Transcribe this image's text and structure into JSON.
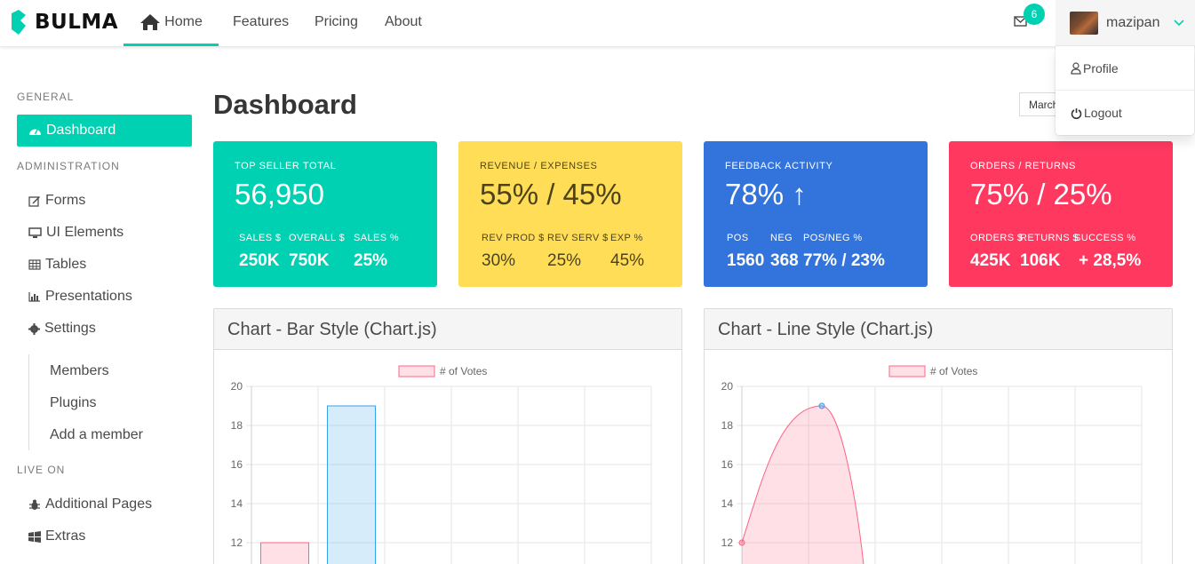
{
  "navbar": {
    "brand": "BULMA",
    "links": [
      "Home",
      "Features",
      "Pricing",
      "About"
    ],
    "messages_count": "6",
    "username": "mazipan"
  },
  "user_menu": {
    "profile": "Profile",
    "logout": "Logout"
  },
  "sidebar": {
    "general_label": "GENERAL",
    "dashboard": "Dashboard",
    "administration_label": "ADMINISTRATION",
    "forms": "Forms",
    "ui_elements": "UI Elements",
    "tables": "Tables",
    "presentations": "Presentations",
    "settings": "Settings",
    "settings_children": [
      "Members",
      "Plugins",
      "Add a member"
    ],
    "live_on_label": "LIVE ON",
    "additional_pages": "Additional Pages",
    "extras": "Extras"
  },
  "main": {
    "title": "Dashboard",
    "month_select": "March"
  },
  "tiles": [
    {
      "label": "TOP SELLER TOTAL",
      "value": "56,950",
      "subs": [
        "SALES $",
        "OVERALL $",
        "SALES %"
      ],
      "nums": [
        "250K",
        "750K",
        "25%"
      ]
    },
    {
      "label": "REVENUE / EXPENSES",
      "value": "55% / 45%",
      "subs": [
        "REV PROD $",
        "REV SERV $",
        "EXP %"
      ],
      "nums": [
        "30%",
        "25%",
        "45%"
      ]
    },
    {
      "label": "FEEDBACK ACTIVITY",
      "value": "78% ↑",
      "subs": [
        "POS",
        "NEG",
        "POS/NEG %"
      ],
      "nums": [
        "1560",
        "368",
        "77% / 23%"
      ]
    },
    {
      "label": "ORDERS / RETURNS",
      "value": "75% / 25%",
      "subs": [
        "ORDERS $",
        "RETURNS $",
        "SUCCESS %"
      ],
      "nums": [
        "425K",
        "106K",
        "+ 28,5%"
      ]
    }
  ],
  "charts": {
    "bar_title": "Chart - Bar Style (Chart.js)",
    "line_title": "Chart - Line Style (Chart.js)"
  },
  "chart_data": [
    {
      "type": "bar",
      "title": "Chart - Bar Style (Chart.js)",
      "legend": "# of Votes",
      "yticks": [
        20,
        18,
        16,
        14,
        12
      ],
      "ylim_visible": [
        11,
        20
      ],
      "values": [
        12,
        19
      ],
      "colors": [
        "#ff6384",
        "#36a2eb"
      ],
      "grid": true
    },
    {
      "type": "line",
      "title": "Chart - Line Style (Chart.js)",
      "legend": "# of Votes",
      "yticks": [
        20,
        18,
        16,
        14,
        12
      ],
      "ylim_visible": [
        11,
        20
      ],
      "values": [
        12,
        19
      ],
      "colors": [
        "#ff6384",
        "#36a2eb"
      ],
      "grid": true
    }
  ]
}
